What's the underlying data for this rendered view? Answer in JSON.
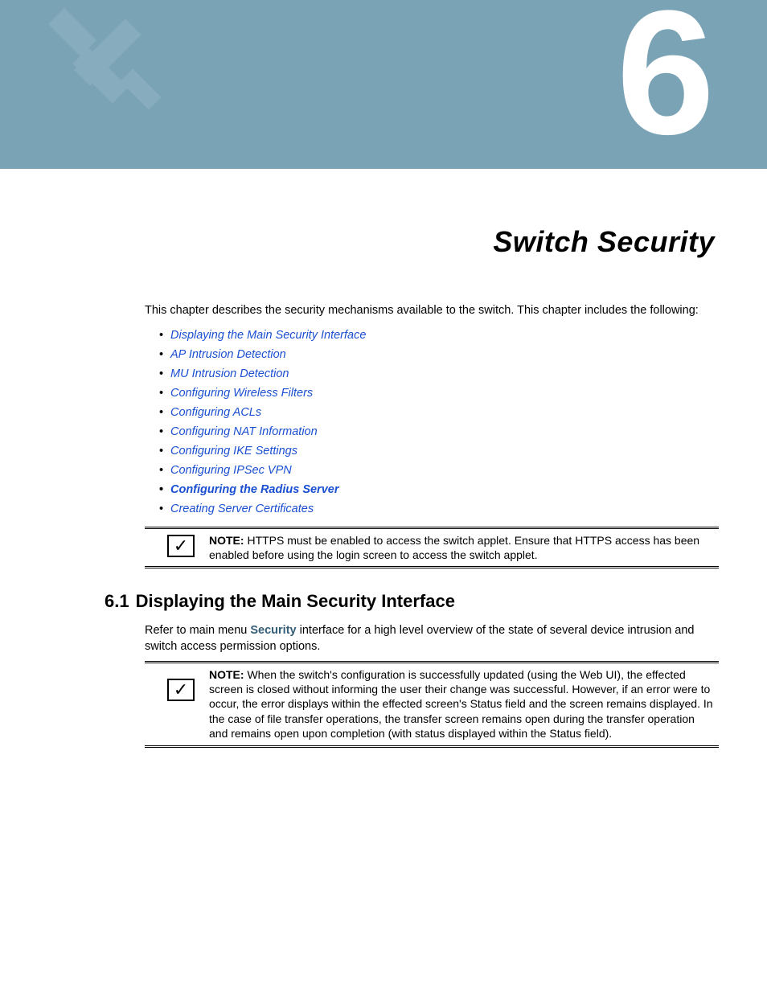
{
  "chapter": {
    "number": "6",
    "title": "Switch Security"
  },
  "intro": "This chapter describes the security mechanisms available to the switch. This chapter includes the following:",
  "links": [
    "Displaying the Main Security Interface",
    "AP Intrusion Detection",
    "MU Intrusion Detection",
    "Configuring Wireless Filters",
    "Configuring ACLs",
    "Configuring NAT Information",
    "Configuring IKE Settings",
    "Configuring IPSec VPN",
    "Configuring the Radius Server",
    "Creating Server Certificates"
  ],
  "note1": {
    "label": "NOTE:",
    "text": " HTTPS must be enabled to access the switch applet. Ensure that HTTPS access has been enabled before using the login screen to access the switch applet."
  },
  "section": {
    "number": "6.1",
    "title": "Displaying the Main Security Interface",
    "body_pre": "Refer to main menu ",
    "body_bold": "Security",
    "body_post": " interface for a high level overview of the state of several device intrusion and switch access permission options."
  },
  "note2": {
    "label": "NOTE:",
    "text": " When the switch's configuration is successfully updated (using the Web UI), the effected screen is closed without informing the user their change was successful. However, if an error were to occur, the error displays within the effected screen's Status field and the screen remains displayed. In the case of file transfer operations, the transfer screen remains open during the transfer operation and remains open upon completion (with status displayed within the Status field)."
  }
}
